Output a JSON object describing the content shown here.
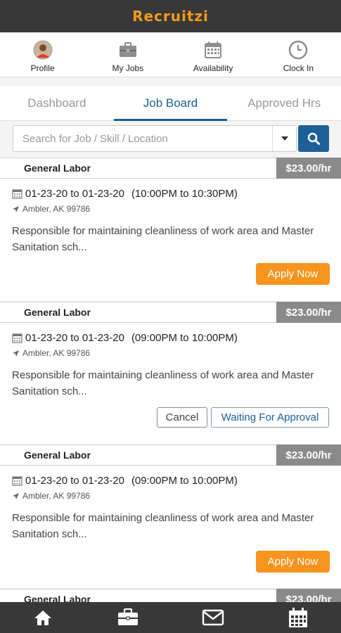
{
  "app": {
    "brand": "Recruitzi"
  },
  "quicknav": [
    {
      "label": "Profile",
      "icon": "avatar"
    },
    {
      "label": "My Jobs",
      "icon": "briefcase-icon"
    },
    {
      "label": "Availability",
      "icon": "calendar-icon"
    },
    {
      "label": "Clock In",
      "icon": "clock-icon"
    }
  ],
  "tabs": [
    {
      "label": "Dashboard",
      "active": false
    },
    {
      "label": "Job Board",
      "active": true
    },
    {
      "label": "Approved Hrs",
      "active": false
    }
  ],
  "search": {
    "placeholder": "Search for Job / Skill / Location"
  },
  "jobs": [
    {
      "title": "General Labor",
      "rate": "$23.00/hr",
      "dates": "01-23-20 to 01-23-20",
      "time": "(10:00PM to 10:30PM)",
      "location": "Ambler, AK 99786",
      "description": "Responsible for maintaining cleanliness of work area and Master Sanitation sch...",
      "apply_label": "Apply Now"
    },
    {
      "title": "General Labor",
      "rate": "$23.00/hr",
      "dates": "01-23-20 to 01-23-20",
      "time": "(09:00PM to 10:00PM)",
      "location": "Ambler, AK 99786",
      "description": "Responsible for maintaining cleanliness of work area and Master Sanitation sch...",
      "cancel_label": "Cancel",
      "status_label": "Waiting For Approval"
    },
    {
      "title": "General Labor",
      "rate": "$23.00/hr",
      "dates": "01-23-20 to 01-23-20",
      "time": "(09:00PM to 10:00PM)",
      "location": "Ambler, AK 99786",
      "description": "Responsible for maintaining cleanliness of work area and Master Sanitation sch...",
      "apply_label": "Apply Now"
    },
    {
      "title": "General Labor",
      "rate": "$23.00/hr"
    }
  ],
  "bottombar": [
    "home-icon",
    "briefcase-icon",
    "mail-icon",
    "calendar-icon"
  ],
  "colors": {
    "topbar": "#383838",
    "brand": "#f39a1e",
    "accent": "#1a5e96",
    "apply": "#f7941d",
    "rate_bg": "#8a8a8a"
  }
}
